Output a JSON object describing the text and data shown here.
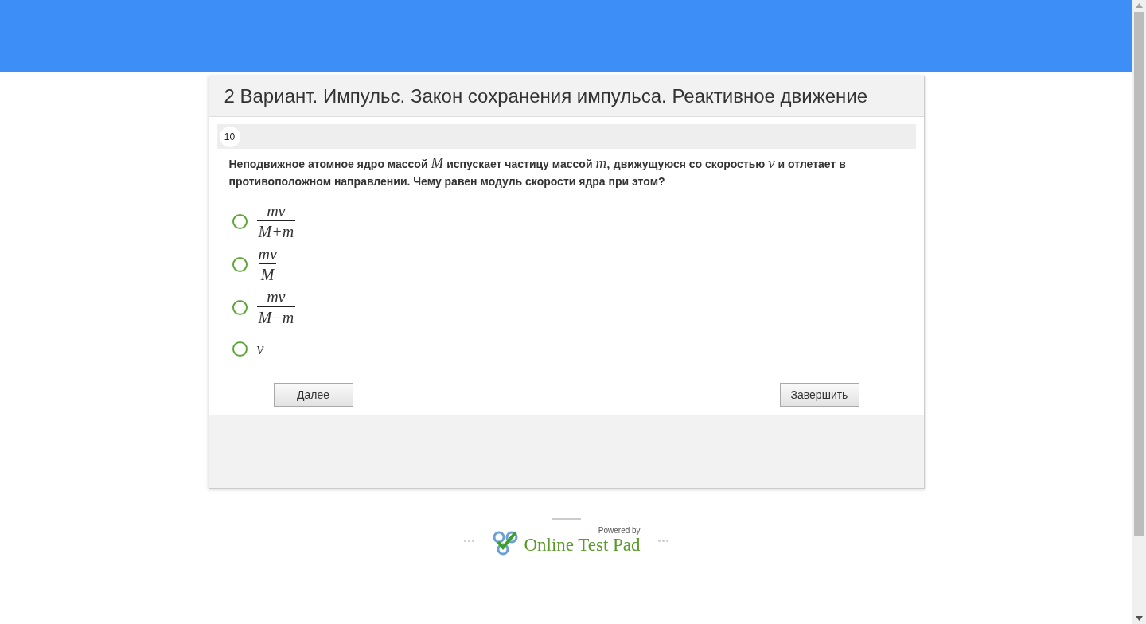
{
  "test_title": "2 Вариант. Импульс. Закон сохранения импульса. Реактивное движение",
  "question": {
    "number": "10",
    "segments": [
      {
        "kind": "text",
        "text": "Неподвижное атомное ядро массой"
      },
      {
        "kind": "math",
        "text": "M"
      },
      {
        "kind": "text",
        "text": "испускает частицу массой"
      },
      {
        "kind": "math",
        "text": "m,"
      },
      {
        "kind": "text",
        "text": "движущуюся со скоростью"
      },
      {
        "kind": "math",
        "text": "v"
      },
      {
        "kind": "text",
        "text": "и отлетает в противоположном направлении. Чему равен модуль скорости ядра при этом?"
      }
    ]
  },
  "options": [
    {
      "kind": "fraction",
      "numerator": "mv",
      "denominator": "M+m",
      "selected": false
    },
    {
      "kind": "fraction",
      "numerator": "mv",
      "denominator": "M",
      "selected": false
    },
    {
      "kind": "fraction",
      "numerator": "mv",
      "denominator": "M−m",
      "selected": false
    },
    {
      "kind": "symbol",
      "text": "v",
      "selected": false
    }
  ],
  "buttons": {
    "next": "Далее",
    "finish": "Завершить"
  },
  "footer": {
    "powered_by": "Powered by",
    "brand": "Online Test Pad"
  }
}
